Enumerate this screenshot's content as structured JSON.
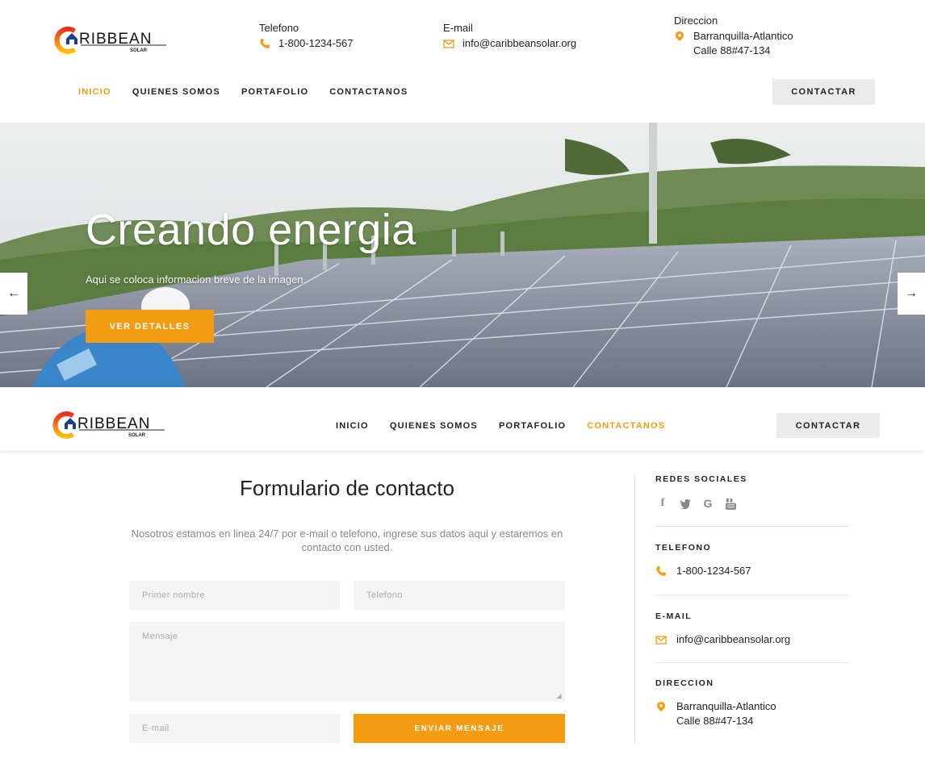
{
  "header": {
    "brand_main": "RIBBEAN",
    "brand_sub": "SOLAR",
    "phone_title": "Telefono",
    "phone": "1-800-1234-567",
    "email_title": "E-mail",
    "email": "info@caribbeansolar.org",
    "address_title": "Direccion",
    "address_line1": "Barranquilla-Atlantico",
    "address_line2": "Calle 88#47-134"
  },
  "nav": {
    "items": [
      "INICIO",
      "QUIENES SOMOS",
      "PORTAFOLIO",
      "CONTACTANOS"
    ],
    "active_top": "INICIO",
    "active_sticky": "CONTACTANOS",
    "cta": "CONTACTAR"
  },
  "hero": {
    "title": "Creando energia",
    "subtitle": "Aqui se coloca informacion breve de la imagen.",
    "button": "VER DETALLES",
    "prev_arrow": "←",
    "next_arrow": "→"
  },
  "form": {
    "title": "Formulario de contacto",
    "description": "Nosotros estamos en linea 24/7 por e-mail o telefono, ingrese sus datos aqui y estaremos en contacto con usted.",
    "first_name_placeholder": "Primer nombre",
    "phone_placeholder": "Telefono",
    "message_placeholder": "Mensaje",
    "email_placeholder": "E-mail",
    "submit": "ENVIAR MENSAJE"
  },
  "sidebar": {
    "social_heading": "REDES SOCIALES",
    "social_icons": [
      "facebook-icon",
      "twitter-icon",
      "google-icon",
      "youtube-icon"
    ],
    "phone_heading": "TELEFONO",
    "phone": "1-800-1234-567",
    "email_heading": "E-MAIL",
    "email": "info@caribbeansolar.org",
    "address_heading": "DIRECCION",
    "address_line1": "Barranquilla-Atlantico",
    "address_line2": "Calle 88#47-134"
  },
  "colors": {
    "accent": "#f39c12",
    "text": "#222222",
    "muted": "#888888",
    "button_gray": "#ebebeb",
    "field_bg": "#f4f4f4"
  }
}
